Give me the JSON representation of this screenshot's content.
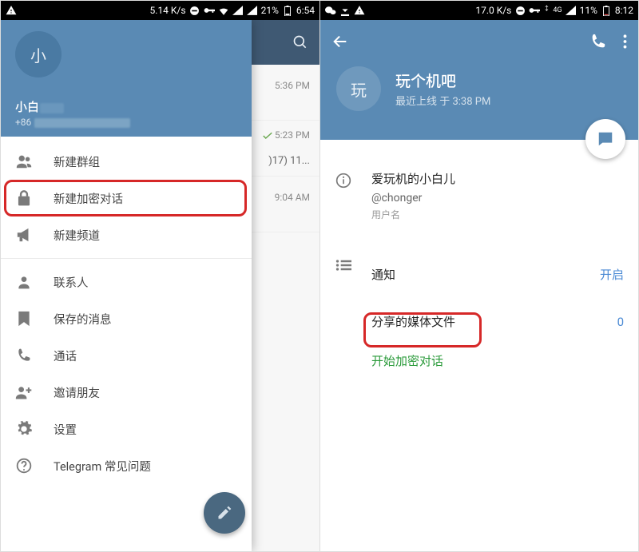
{
  "left": {
    "statusbar": {
      "speed": "5.14 K/s",
      "battery": "21%",
      "clock": "6:54"
    },
    "header_bg_times": [
      "5:36 PM"
    ],
    "chat2_time": "5:23 PM",
    "chat2_sub": ")17) 11...",
    "chat3_time": "9:04 AM",
    "drawer": {
      "avatar_letter": "小",
      "name": "小白",
      "phone_prefix": "+86",
      "items": {
        "new_group": "新建群组",
        "new_secret": "新建加密对话",
        "new_channel": "新建频道",
        "contacts": "联系人",
        "saved": "保存的消息",
        "calls": "通话",
        "invite": "邀请朋友",
        "settings": "设置",
        "faq": "Telegram 常见问题"
      }
    }
  },
  "right": {
    "statusbar": {
      "speed": "17.0 K/s",
      "net": "4G",
      "battery": "11%",
      "clock": "8:12"
    },
    "profile": {
      "avatar_letter": "玩",
      "name": "玩个机吧",
      "last_seen": "最近上线 于 3:38 PM"
    },
    "info": {
      "display_name": "爱玩机的小白儿",
      "username": "@chonger",
      "username_caption": "用户名"
    },
    "settings": {
      "notifications_label": "通知",
      "notifications_value": "开启",
      "shared_media_label": "分享的媒体文件",
      "shared_media_value": "0",
      "start_secret": "开始加密对话"
    }
  }
}
